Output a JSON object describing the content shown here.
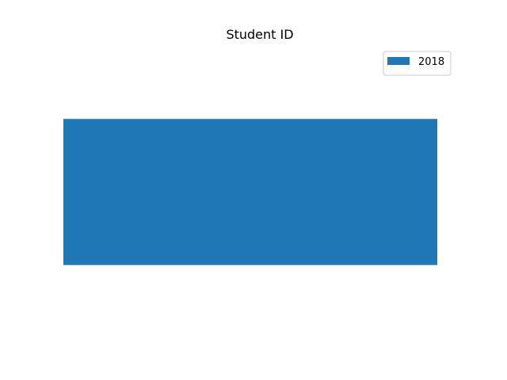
{
  "chart_data": {
    "type": "bar",
    "orientation": "horizontal",
    "title": "Student ID",
    "xlabel": "",
    "ylabel": "",
    "axes_visible": false,
    "grid": false,
    "legend_position": "top-right",
    "categories": [
      ""
    ],
    "series": [
      {
        "name": "2018",
        "values": [
          1
        ],
        "color": "#1f77b4"
      }
    ]
  }
}
